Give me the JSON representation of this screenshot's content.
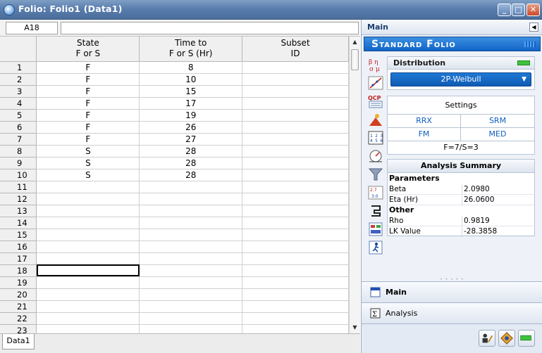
{
  "window": {
    "title": "Folio: Folio1 (Data1)",
    "min": "_",
    "max": "□",
    "close": "✕"
  },
  "formula": {
    "cell_ref": "A18",
    "value": ""
  },
  "columns": [
    {
      "line1": "State",
      "line2": "F or S"
    },
    {
      "line1": "Time to",
      "line2": "F or S (Hr)"
    },
    {
      "line1": "Subset",
      "line2": "ID"
    }
  ],
  "rows": [
    {
      "n": "1",
      "state": "F",
      "time": "8",
      "subset": ""
    },
    {
      "n": "2",
      "state": "F",
      "time": "10",
      "subset": ""
    },
    {
      "n": "3",
      "state": "F",
      "time": "15",
      "subset": ""
    },
    {
      "n": "4",
      "state": "F",
      "time": "17",
      "subset": ""
    },
    {
      "n": "5",
      "state": "F",
      "time": "19",
      "subset": ""
    },
    {
      "n": "6",
      "state": "F",
      "time": "26",
      "subset": ""
    },
    {
      "n": "7",
      "state": "F",
      "time": "27",
      "subset": ""
    },
    {
      "n": "8",
      "state": "S",
      "time": "28",
      "subset": ""
    },
    {
      "n": "9",
      "state": "S",
      "time": "28",
      "subset": ""
    },
    {
      "n": "10",
      "state": "S",
      "time": "28",
      "subset": ""
    },
    {
      "n": "11",
      "state": "",
      "time": "",
      "subset": ""
    },
    {
      "n": "12",
      "state": "",
      "time": "",
      "subset": ""
    },
    {
      "n": "13",
      "state": "",
      "time": "",
      "subset": ""
    },
    {
      "n": "14",
      "state": "",
      "time": "",
      "subset": ""
    },
    {
      "n": "15",
      "state": "",
      "time": "",
      "subset": ""
    },
    {
      "n": "16",
      "state": "",
      "time": "",
      "subset": ""
    },
    {
      "n": "17",
      "state": "",
      "time": "",
      "subset": ""
    },
    {
      "n": "18",
      "state": "",
      "time": "",
      "subset": ""
    },
    {
      "n": "19",
      "state": "",
      "time": "",
      "subset": ""
    },
    {
      "n": "20",
      "state": "",
      "time": "",
      "subset": ""
    },
    {
      "n": "21",
      "state": "",
      "time": "",
      "subset": ""
    },
    {
      "n": "22",
      "state": "",
      "time": "",
      "subset": ""
    },
    {
      "n": "23",
      "state": "",
      "time": "",
      "subset": ""
    }
  ],
  "selected_row": "18",
  "sheet_tab": "Data1",
  "panel": {
    "header": "Main",
    "banner": "Standard Folio",
    "distribution": {
      "title": "Distribution",
      "selected": "2P-Weibull"
    },
    "settings": {
      "title": "Settings",
      "rrx": "RRX",
      "srm": "SRM",
      "fm": "FM",
      "med": "MED",
      "fs": "F=7/S=3"
    },
    "summary": {
      "title": "Analysis Summary",
      "parameters_label": "Parameters",
      "beta_label": "Beta",
      "beta": "2.0980",
      "eta_label": "Eta (Hr)",
      "eta": "26.0600",
      "other_label": "Other",
      "rho_label": "Rho",
      "rho": "0.9819",
      "lk_label": "LK Value",
      "lk": "-28.3858"
    },
    "nav_main": "Main",
    "nav_analysis": "Analysis"
  },
  "toolbar_icons": [
    "beta-eta-icon",
    "plot-line-icon",
    "qcp-icon",
    "sun-triangle-icon",
    "matrix-icon",
    "gauge-icon",
    "funnel-icon",
    "arrow-convert-icon",
    "magnet-icon",
    "report-icon",
    "run-figure-icon"
  ],
  "colors": {
    "title_bar": "#5a7eae",
    "accent_blue": "#1364c8",
    "link_blue": "#1060c0",
    "green": "#3ec23e"
  }
}
